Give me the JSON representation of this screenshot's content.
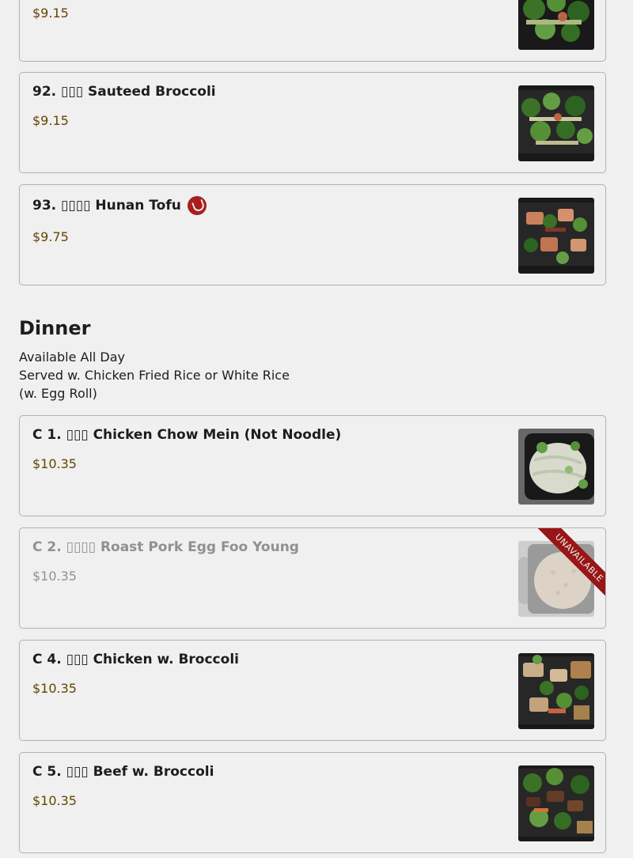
{
  "items_top": [
    {
      "price": "$9.15"
    },
    {
      "name": "92. ▯▯▯ Sauteed Broccoli",
      "price": "$9.15"
    },
    {
      "name": "93. ▯▯▯▯ Hunan Tofu",
      "price": "$9.75",
      "spicy": true
    }
  ],
  "dinner": {
    "title": "Dinner",
    "desc_1": "Available All Day",
    "desc_2": "Served w. Chicken Fried Rice or White Rice",
    "desc_3": "(w. Egg Roll)",
    "items": [
      {
        "name": "C 1. ▯▯▯ Chicken Chow Mein (Not Noodle)",
        "price": "$10.35"
      },
      {
        "name": "C 2. ▯▯▯▯ Roast Pork Egg Foo Young",
        "price": "$10.35",
        "badge": "UNAVAILABLE"
      },
      {
        "name": "C 4. ▯▯▯ Chicken w. Broccoli",
        "price": "$10.35"
      },
      {
        "name": "C 5. ▯▯▯ Beef w. Broccoli",
        "price": "$10.35"
      }
    ]
  },
  "colors": {
    "price": "#6b4a00",
    "badge": "#a11818",
    "spicy": "#b32020"
  }
}
